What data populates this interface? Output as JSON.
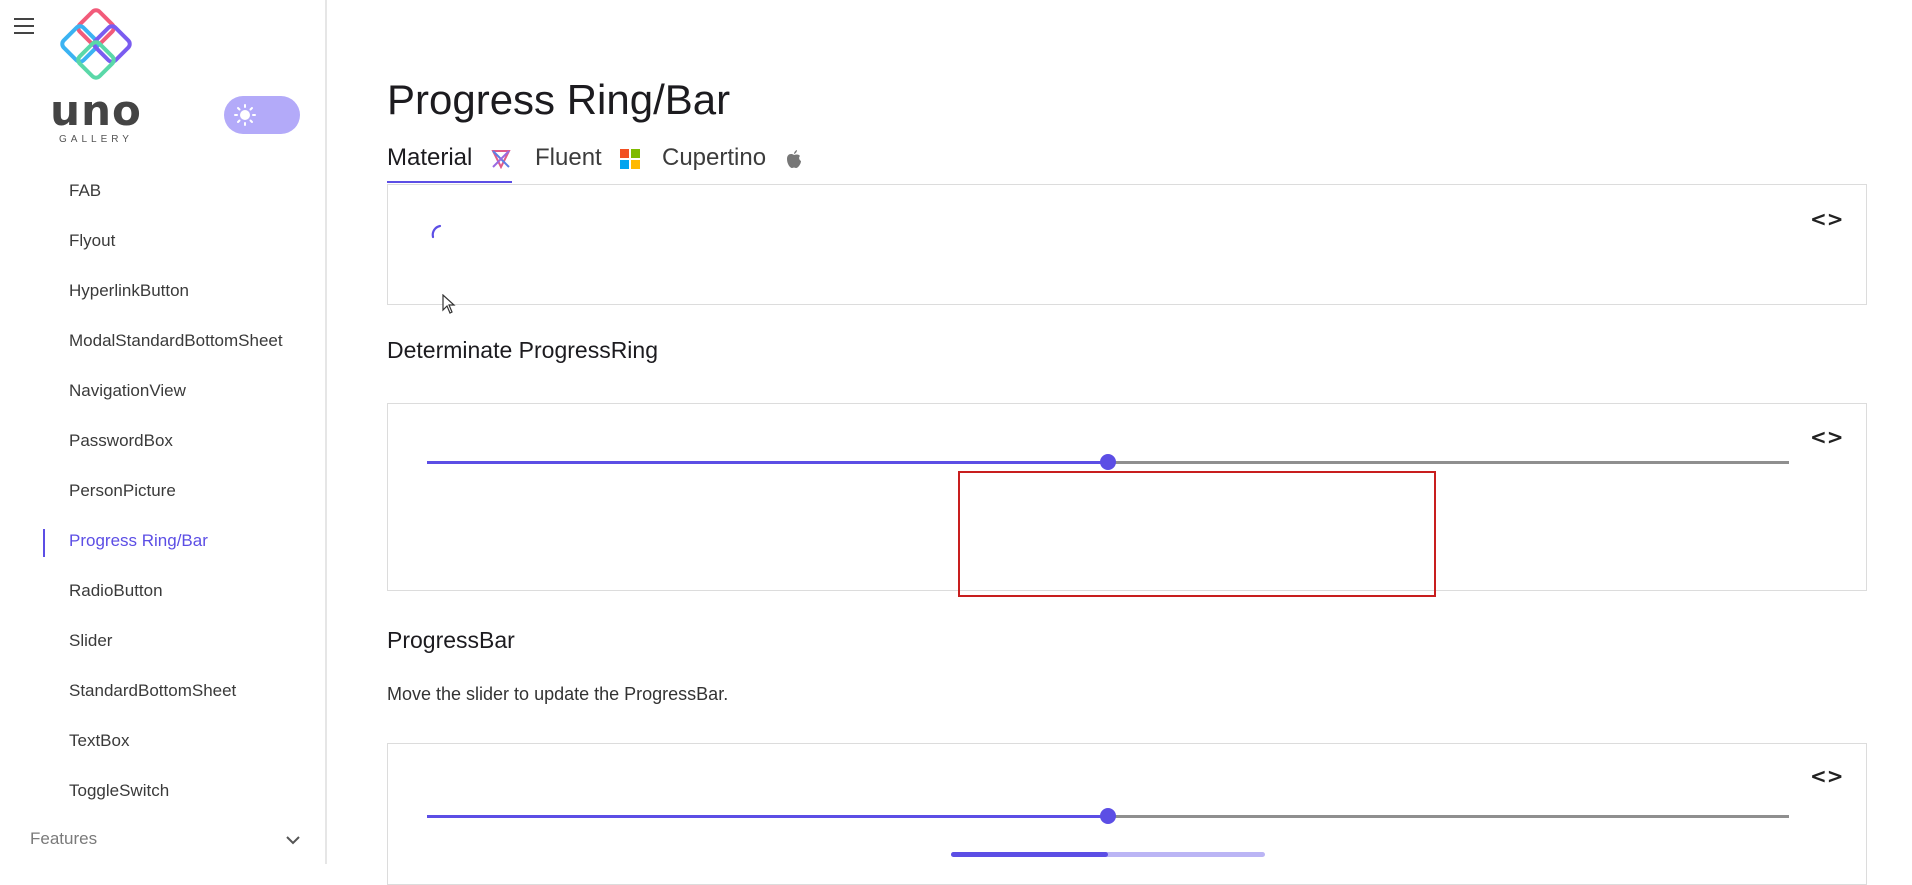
{
  "app": {
    "brand": "uno",
    "brand_sub": "GALLERY",
    "accent": "#5c4ee5"
  },
  "sidebar": {
    "items": [
      {
        "label": "FAB",
        "active": false
      },
      {
        "label": "Flyout",
        "active": false
      },
      {
        "label": "HyperlinkButton",
        "active": false
      },
      {
        "label": "ModalStandardBottomSheet",
        "active": false
      },
      {
        "label": "NavigationView",
        "active": false
      },
      {
        "label": "PasswordBox",
        "active": false
      },
      {
        "label": "PersonPicture",
        "active": false
      },
      {
        "label": "Progress Ring/Bar",
        "active": true
      },
      {
        "label": "RadioButton",
        "active": false
      },
      {
        "label": "Slider",
        "active": false
      },
      {
        "label": "StandardBottomSheet",
        "active": false
      },
      {
        "label": "TextBox",
        "active": false
      },
      {
        "label": "ToggleSwitch",
        "active": false
      }
    ],
    "features_label": "Features",
    "icons": {
      "menu": "hamburger-menu-icon",
      "theme": "sun-icon",
      "expand": "chevron-down-icon"
    }
  },
  "main": {
    "title": "Progress Ring/Bar",
    "tabs": [
      {
        "label": "Material",
        "icon": "material-icon",
        "active": true
      },
      {
        "label": "Fluent",
        "icon": "windows-logo-icon",
        "active": false
      },
      {
        "label": "Cupertino",
        "icon": "apple-logo-icon",
        "active": false
      }
    ],
    "code_toggle_label": "<>",
    "determinate_ring": {
      "heading": "Determinate ProgressRing",
      "slider_value": 0.5
    },
    "progress_bar": {
      "heading": "ProgressBar",
      "description": "Move the slider to update the ProgressBar.",
      "slider_value": 0.5,
      "bar_value": 0.5
    }
  }
}
